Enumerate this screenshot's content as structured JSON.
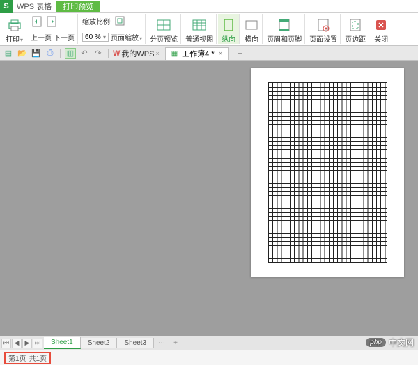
{
  "titlebar": {
    "app": "S",
    "title": "WPS 表格",
    "tab": "打印预览"
  },
  "ribbon": {
    "print": "打印",
    "prev_page": "上一页",
    "next_page": "下一页",
    "zoom_label": "缩放比例:",
    "zoom_value": "60 %",
    "page_zoom": "页面缩放",
    "page_break": "分页预览",
    "normal_view": "普通视图",
    "portrait": "纵向",
    "landscape": "横向",
    "header_footer": "页眉和页脚",
    "page_setup": "页面设置",
    "margins": "页边距",
    "close": "关闭"
  },
  "qat": {
    "mywps": "我的WPS",
    "doc": "工作簿4 *"
  },
  "sheets": {
    "s1": "Sheet1",
    "s2": "Sheet2",
    "s3": "Sheet3"
  },
  "status": {
    "page": "第1页",
    "total": "共1页"
  },
  "brand": {
    "php": "php",
    "cn": "中文网"
  }
}
